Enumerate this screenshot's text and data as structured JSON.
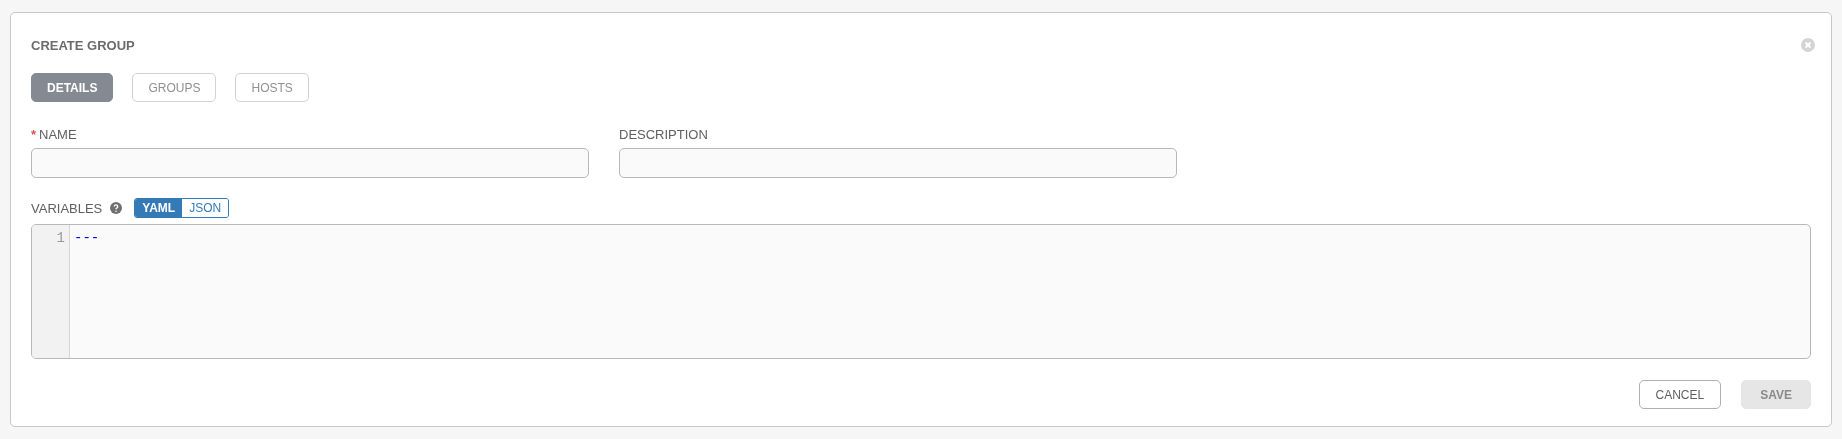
{
  "dialog": {
    "title": "CREATE GROUP"
  },
  "tabs": [
    {
      "label": "DETAILS",
      "selected": true
    },
    {
      "label": "GROUPS",
      "selected": false
    },
    {
      "label": "HOSTS",
      "selected": false
    }
  ],
  "fields": [
    {
      "label": "NAME",
      "required_mark": "*"
    },
    {
      "label": "DESCRIPTION"
    }
  ],
  "variables": {
    "label": "VARIABLES",
    "modes": [
      {
        "label": "YAML",
        "selected": true
      },
      {
        "label": "JSON",
        "selected": false
      }
    ],
    "lines": [
      {
        "number": "1",
        "text": "---"
      }
    ]
  },
  "buttons": [
    {
      "label": "CANCEL",
      "disabled": false
    },
    {
      "label": "SAVE",
      "disabled": true
    }
  ]
}
